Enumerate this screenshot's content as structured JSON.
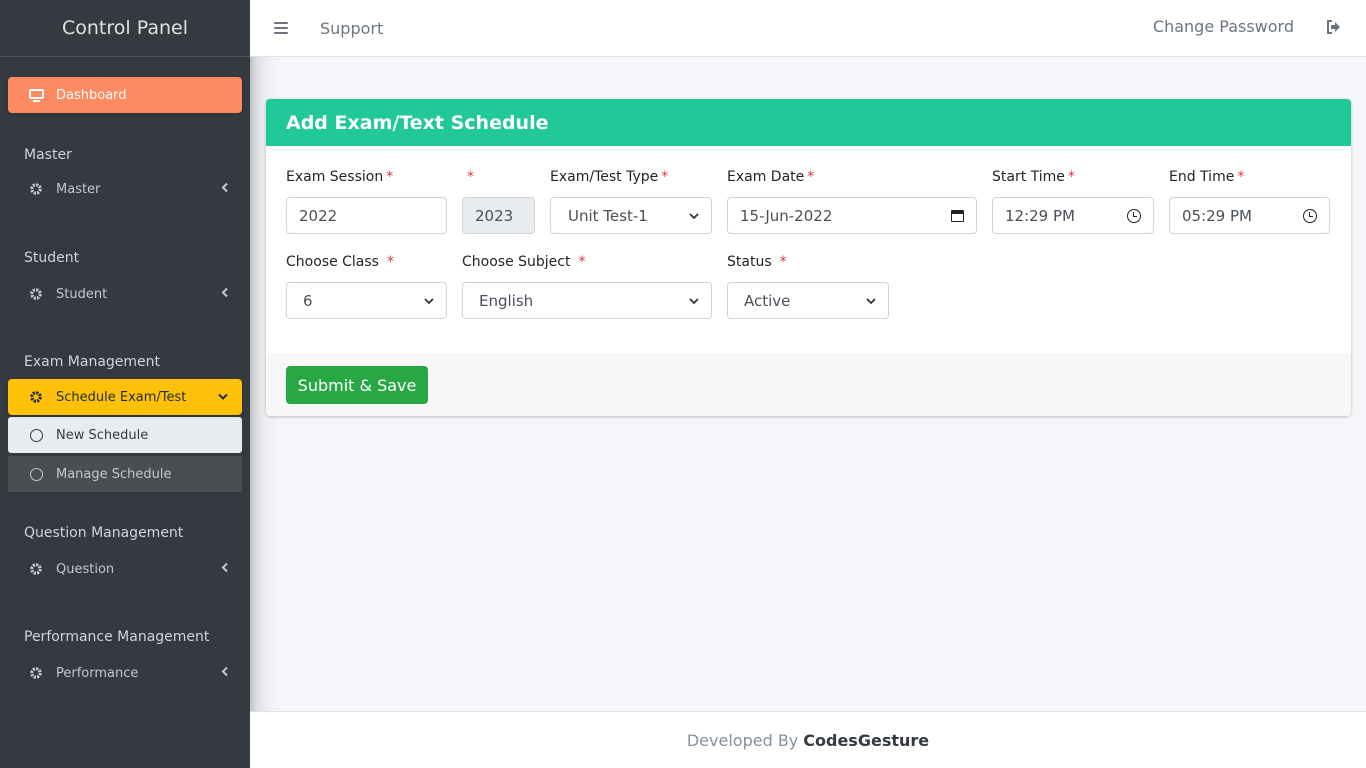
{
  "sidebar": {
    "brand": "Control Panel",
    "dashboard": "Dashboard",
    "sections": {
      "master": {
        "header": "Master",
        "item": "Master"
      },
      "student": {
        "header": "Student",
        "item": "Student"
      },
      "exam": {
        "header": "Exam Management",
        "item": "Schedule Exam/Test",
        "subitems": [
          "New Schedule",
          "Manage Schedule"
        ]
      },
      "question": {
        "header": "Question Management",
        "item": "Question"
      },
      "performance": {
        "header": "Performance Management",
        "item": "Performance"
      }
    },
    "colors": {
      "bg": "#343a40",
      "dashboard": "#fd8a60",
      "active": "#ffc107"
    }
  },
  "topbar": {
    "support": "Support",
    "change_password": "Change Password"
  },
  "card": {
    "title": "Add Exam/Text Schedule",
    "header_color": "#20c997",
    "fields": {
      "exam_session": {
        "label": "Exam Session",
        "value": "2022"
      },
      "session_end": {
        "label": "",
        "value": "2023"
      },
      "exam_type": {
        "label": "Exam/Test Type",
        "value": "Unit Test-1"
      },
      "exam_date": {
        "label": "Exam Date",
        "value": "15-Jun-2022"
      },
      "start_time": {
        "label": "Start Time",
        "value": "12:29 PM"
      },
      "end_time": {
        "label": "End Time",
        "value": "05:29 PM"
      },
      "class": {
        "label": "Choose Class",
        "value": "6"
      },
      "subject": {
        "label": "Choose Subject",
        "value": "English"
      },
      "status": {
        "label": "Status",
        "value": "Active"
      }
    },
    "required_mark": "*",
    "submit": "Submit & Save"
  },
  "footer": {
    "prefix": "Developed By",
    "brand": "CodesGesture"
  }
}
